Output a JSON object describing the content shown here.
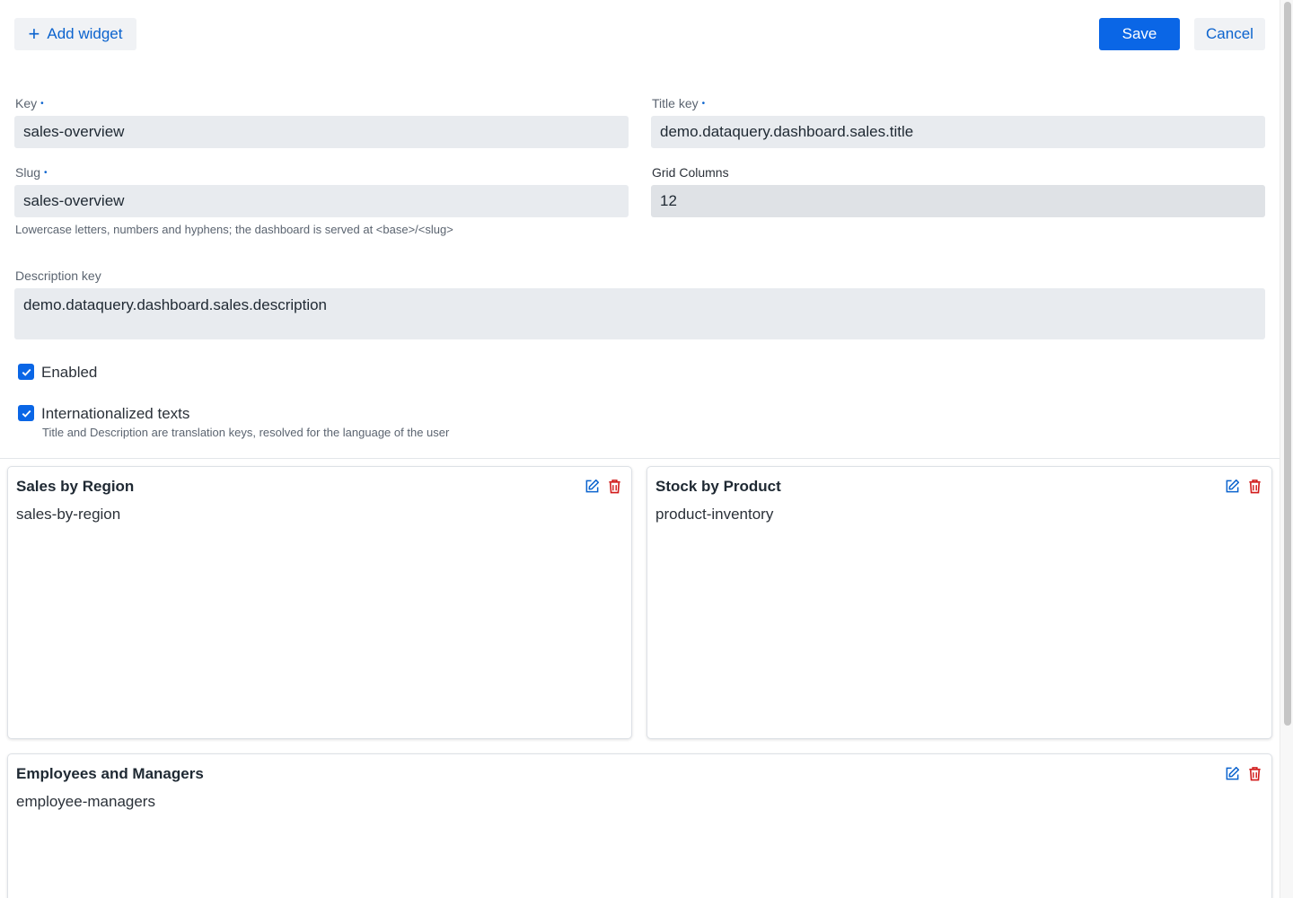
{
  "toolbar": {
    "add_widget_label": "Add widget",
    "save_label": "Save",
    "cancel_label": "Cancel"
  },
  "form": {
    "key": {
      "label": "Key",
      "value": "sales-overview",
      "required": true
    },
    "title_key": {
      "label": "Title key",
      "value": "demo.dataquery.dashboard.sales.title",
      "required": true
    },
    "slug": {
      "label": "Slug",
      "value": "sales-overview",
      "required": true,
      "hint": "Lowercase letters, numbers and hyphens; the dashboard is served at <base>/<slug>"
    },
    "grid_columns": {
      "label": "Grid Columns",
      "value": "12"
    },
    "description_key": {
      "label": "Description key",
      "value": "demo.dataquery.dashboard.sales.description"
    },
    "enabled": {
      "label": "Enabled",
      "checked": true
    },
    "i18n": {
      "label": "Internationalized texts",
      "checked": true,
      "hint": "Title and Description are translation keys, resolved for the language of the user"
    },
    "required_marker": "•"
  },
  "widgets": [
    {
      "title": "Sales by Region",
      "key": "sales-by-region"
    },
    {
      "title": "Stock by Product",
      "key": "product-inventory"
    },
    {
      "title": "Employees and Managers",
      "key": "employee-managers"
    }
  ],
  "colors": {
    "primary": "#0a66e6",
    "link": "#0b63ce",
    "delete": "#d11a1a",
    "field_bg": "#e8ebef"
  },
  "icons": {
    "add": "plus-icon",
    "edit": "edit-icon",
    "delete": "trash-icon",
    "checkbox": "check-icon"
  }
}
